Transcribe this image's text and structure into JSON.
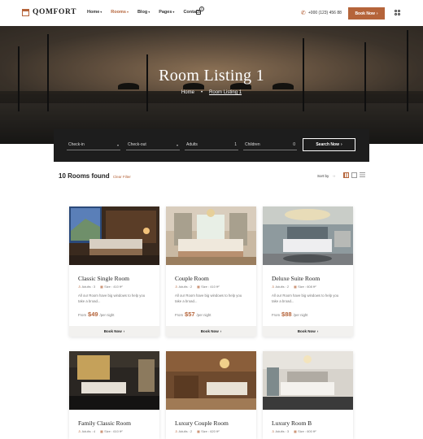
{
  "brand": {
    "name": "QOMFORT",
    "accent": "#b5643a"
  },
  "nav": [
    {
      "label": "Home",
      "chevron": "▾",
      "active": false
    },
    {
      "label": "Rooms",
      "chevron": "▾",
      "active": true
    },
    {
      "label": "Blog",
      "chevron": "▾",
      "active": false
    },
    {
      "label": "Pages",
      "chevron": "▾",
      "active": false
    },
    {
      "label": "Contact",
      "chevron": "",
      "active": false
    }
  ],
  "cart": {
    "count": "0"
  },
  "phone": "+000 (123) 456 88",
  "header_button": {
    "label": "Book Now",
    "arrow": "›"
  },
  "hero": {
    "title": "Room Listing 1",
    "breadcrumb": {
      "home": "Home",
      "separator": "•",
      "current": "Room Listing 1"
    }
  },
  "search": {
    "checkin": "Check-in",
    "checkout": "Check-out",
    "adults_label": "Adults",
    "adults_value": "1",
    "children_label": "Children",
    "children_value": "0",
    "button": "Search Now",
    "button_arrow": "›"
  },
  "results": {
    "count": "10",
    "label": "Rooms found",
    "clear": "Clear Filter",
    "sort": "Sort by",
    "sort_arrows": "‹›"
  },
  "rooms": [
    {
      "name": "Classic Single Room",
      "adults": "Adults : 3",
      "size": "Size : 410 ft²",
      "desc": "All our Room have big windows to help you take a broad...",
      "from": "From",
      "price": "$49",
      "per": "/per night",
      "button": "Book Now",
      "arrow": "›"
    },
    {
      "name": "Couple Room",
      "adults": "Adults : 2",
      "size": "Size : 410 ft²",
      "desc": "All our Room have big windows to help you take a broad...",
      "from": "From",
      "price": "$57",
      "per": "/per night",
      "button": "Book Now",
      "arrow": "›"
    },
    {
      "name": "Deluxe Suite Room",
      "adults": "Adults : 2",
      "size": "Size : 608 ft²",
      "desc": "All our Room have big windows to help you take a broad...",
      "from": "From",
      "price": "$88",
      "per": "/per night",
      "button": "Book Now",
      "arrow": "›"
    },
    {
      "name": "Family Classic Room",
      "adults": "Adults : 4",
      "size": "Size : 610 ft²"
    },
    {
      "name": "Luxury Couple Room",
      "adults": "Adults : 2",
      "size": "Size : 620 ft²"
    },
    {
      "name": "Luxury Room B",
      "adults": "Adults : 3",
      "size": "Size : 600 ft²"
    }
  ]
}
